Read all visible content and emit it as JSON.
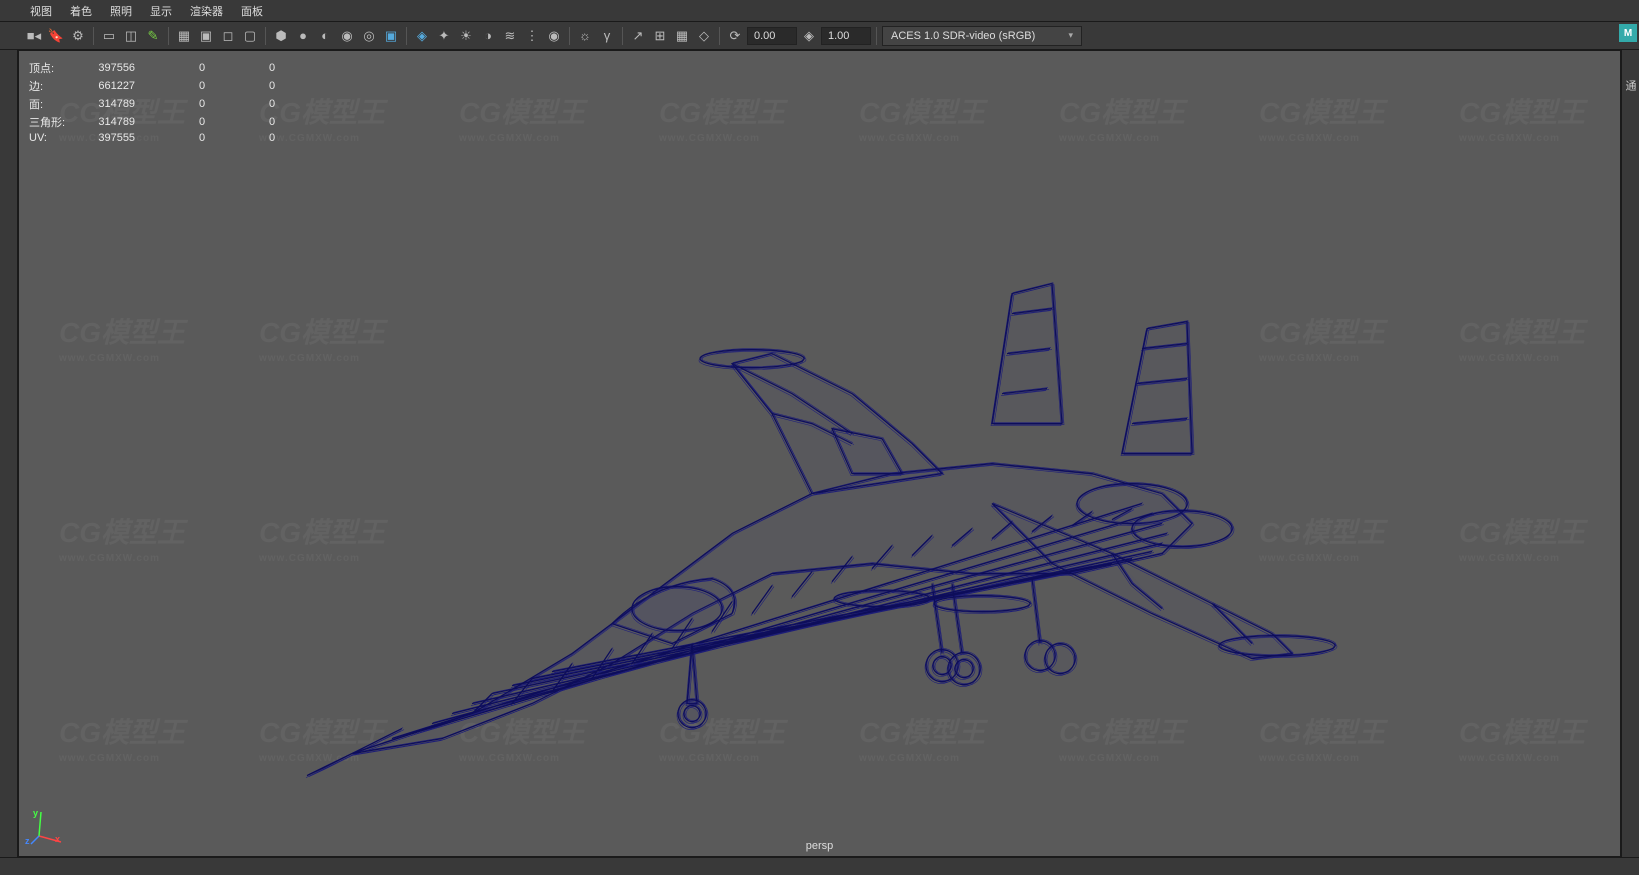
{
  "menu": {
    "items": [
      "视图",
      "着色",
      "照明",
      "显示",
      "渲染器",
      "面板"
    ]
  },
  "toolbar": {
    "time_a": "0.00",
    "time_b": "1.00",
    "color_profile": "ACES 1.0 SDR-video (sRGB)"
  },
  "hud": {
    "rows": [
      {
        "label": "顶点:",
        "c1": "397556",
        "c2": "0",
        "c3": "0"
      },
      {
        "label": "边:",
        "c1": "661227",
        "c2": "0",
        "c3": "0"
      },
      {
        "label": "面:",
        "c1": "314789",
        "c2": "0",
        "c3": "0"
      },
      {
        "label": "三角形:",
        "c1": "314789",
        "c2": "0",
        "c3": "0"
      },
      {
        "label": "UV:",
        "c1": "397555",
        "c2": "0",
        "c3": "0"
      }
    ]
  },
  "viewport": {
    "camera": "persp"
  },
  "watermark": {
    "brand": "CG模型王",
    "url": "www.CGMXW.com"
  },
  "right_panel_hint": "通",
  "logo": "M"
}
